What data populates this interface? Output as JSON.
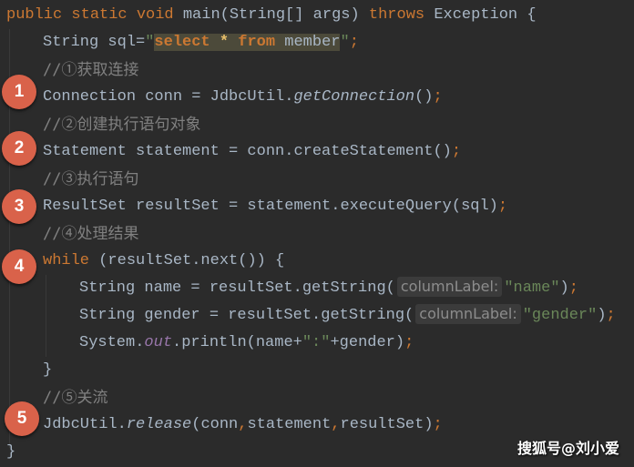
{
  "code": {
    "l1": {
      "kw": "public static void ",
      "t1": "main(String[] args) ",
      "kw2": "throws ",
      "t2": "Exception {"
    },
    "l2": {
      "t1": "String sql=",
      "q1": "\"",
      "sk1": "select",
      "sp1": " ",
      "star": "*",
      "sp2": " ",
      "sk2": "from",
      "sid": " member",
      "q2": "\"",
      "semi": ";"
    },
    "l3": {
      "comment": "//①获取连接"
    },
    "l4": {
      "t1": "Connection conn = JdbcUtil.",
      "it": "getConnection",
      "t2": "()",
      "semi": ";"
    },
    "l5": {
      "comment": "//②创建执行语句对象"
    },
    "l6": {
      "t1": "Statement statement = conn.createStatement()",
      "semi": ";"
    },
    "l7": {
      "comment": "//③执行语句"
    },
    "l8": {
      "t1": "ResultSet resultSet = statement.executeQuery(sql)",
      "semi": ";"
    },
    "l9": {
      "comment": "//④处理结果"
    },
    "l10": {
      "kw": "while",
      "t1": " (resultSet.next()) {"
    },
    "l11": {
      "t1": "String name = resultSet.getString(",
      "hint": "columnLabel:",
      "str": "\"name\"",
      "t2": ")",
      "semi": ";"
    },
    "l12": {
      "t1": "String gender = resultSet.getString(",
      "hint": "columnLabel:",
      "str": "\"gender\"",
      "t2": ")",
      "semi": ";"
    },
    "l13": {
      "t1": "System.",
      "fld": "out",
      "t2": ".println(name+",
      "str": "\":\"",
      "t3": "+gender)",
      "semi": ";"
    },
    "l14": {
      "t1": "}"
    },
    "l15": {
      "comment": "//⑤关流"
    },
    "l16": {
      "t1": "JdbcUtil.",
      "it": "release",
      "t2": "(conn",
      "c1": ",",
      "t3": "statement",
      "c2": ",",
      "t4": "resultSet)",
      "semi": ";"
    },
    "l17": {
      "t1": "}"
    }
  },
  "badges": [
    "1",
    "2",
    "3",
    "4",
    "5"
  ],
  "watermark": "搜狐号@刘小爱",
  "colors": {
    "badge": "#d9624a",
    "keyword": "#cc7832",
    "string": "#6a8759",
    "comment": "#808080",
    "background": "#2b2b2b"
  }
}
